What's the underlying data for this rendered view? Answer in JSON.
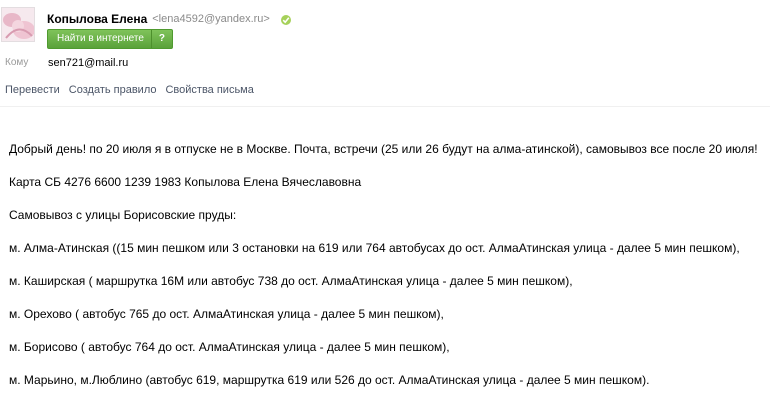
{
  "header": {
    "sender_name": "Копылова Елена",
    "sender_email": "<lena4592@yandex.ru>",
    "find_button_label": "Найти в интернете",
    "find_help_label": "?"
  },
  "recipient": {
    "label": "Кому",
    "value": "sen721@mail.ru"
  },
  "actions": {
    "translate": "Перевести",
    "create_rule": "Создать правило",
    "properties": "Свойства письма"
  },
  "message": {
    "lines": [
      "Добрый день! по 20 июля я в отпуске не в Москве.  Почта, встречи (25 или 26 будут на алма-атинской), самовывоз все  после 20 июля!",
      "Карта СБ 4276 6600 1239 1983 Копылова Елена Вячеславовна",
      "Самовывоз с улицы Борисовские пруды:",
      "м. Алма-Атинская ((15 мин пешком или 3 остановки на 619 или 764 автобусах до ост. АлмаАтинская улица - далее 5 мин пешком),",
      "м. Каширская ( маршрутка 16М или автобус 738 до ост. АлмаАтинская улица - далее 5 мин пешком),",
      "м. Орехово ( автобус 765 до ост. АлмаАтинская улица - далее 5 мин пешком),",
      "м. Борисово ( автобус 764 до ост. АлмаАтинская улица - далее 5 мин пешком),",
      "м. Марьино, м.Люблино (автобус 619, маршрутка 619 или 526 до ост. АлмаАтинская улица - далее 5 мин пешком)."
    ]
  },
  "colors": {
    "button_green": "#5aa23a",
    "link_gray": "#4b5567",
    "email_gray": "#8a8a8a"
  },
  "icons": {
    "verified": "verified-check-icon",
    "avatar": "sender-avatar"
  }
}
